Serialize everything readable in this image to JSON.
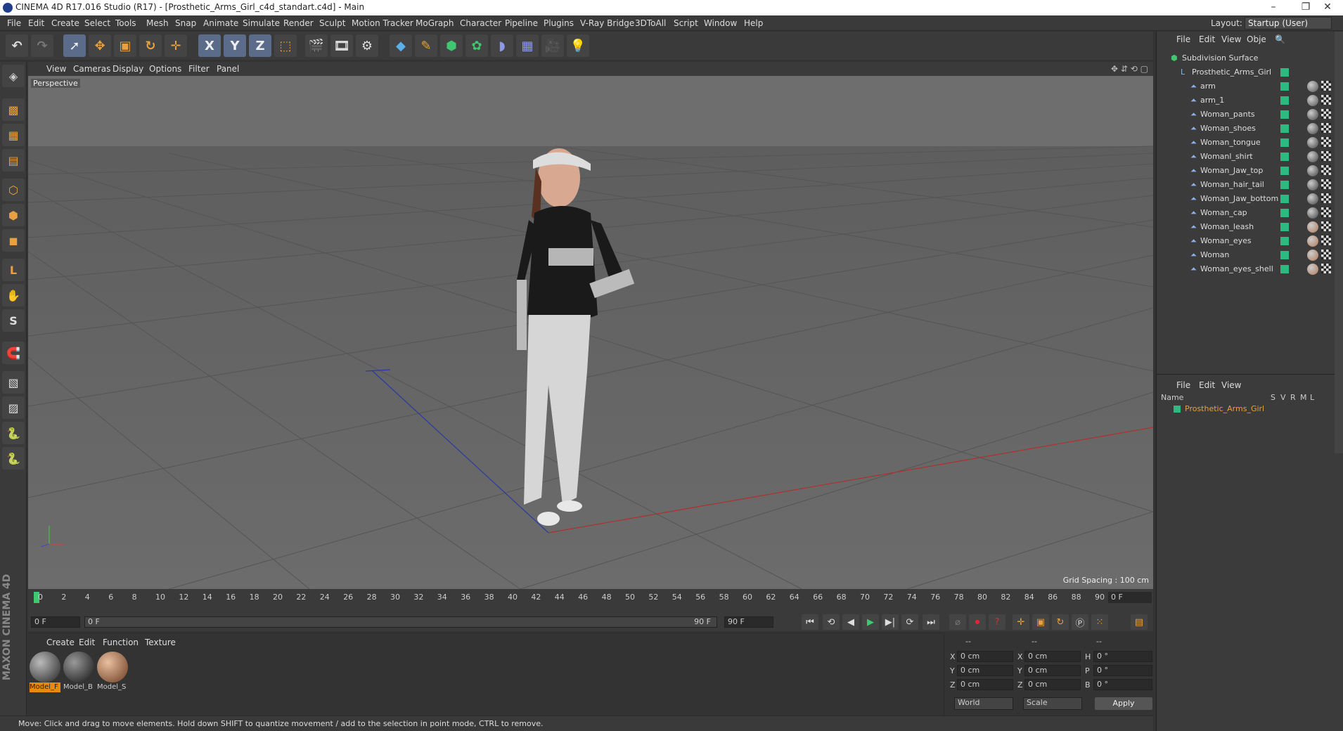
{
  "titlebar": {
    "title": "CINEMA 4D R17.016 Studio (R17) - [Prosthetic_Arms_Girl_c4d_standart.c4d] - Main",
    "minimize": "–",
    "restore": "❐",
    "close": "✕"
  },
  "menubar": {
    "items": [
      "File",
      "Edit",
      "Create",
      "Select",
      "Tools",
      "Mesh",
      "Snap",
      "Animate",
      "Simulate",
      "Render",
      "Sculpt",
      "Motion Tracker",
      "MoGraph",
      "Character",
      "Pipeline",
      "Plugins",
      "V-Ray Bridge",
      "3DToAll",
      "Script",
      "Window",
      "Help"
    ],
    "layout_label": "Layout:",
    "layout_value": "Startup (User)"
  },
  "toolbar": {
    "x_label": "X",
    "y_label": "Y",
    "z_label": "Z"
  },
  "viewport_menu": {
    "items": [
      "View",
      "Cameras",
      "Display",
      "Options",
      "Filter",
      "Panel"
    ]
  },
  "viewport": {
    "camera": "Perspective",
    "grid_spacing": "Grid Spacing : 100 cm"
  },
  "timeline": {
    "ticks": [
      "0",
      "2",
      "4",
      "6",
      "8",
      "10",
      "12",
      "14",
      "16",
      "18",
      "20",
      "22",
      "24",
      "26",
      "28",
      "30",
      "32",
      "34",
      "36",
      "38",
      "40",
      "42",
      "44",
      "46",
      "48",
      "50",
      "52",
      "54",
      "56",
      "58",
      "60",
      "62",
      "64",
      "66",
      "68",
      "70",
      "72",
      "74",
      "76",
      "78",
      "80",
      "82",
      "84",
      "86",
      "88",
      "90"
    ],
    "frame_display": "0 F"
  },
  "transport": {
    "start_frame": "0 F",
    "range_start": "0 F",
    "range_end": "90 F",
    "end_frame": "90 F"
  },
  "material_panel": {
    "menu": [
      "Create",
      "Edit",
      "Function",
      "Texture"
    ],
    "materials": [
      {
        "name": "Model_F",
        "color": "#444"
      },
      {
        "name": "Model_B",
        "color": "#222"
      },
      {
        "name": "Model_S",
        "color": "#b07a5a"
      }
    ]
  },
  "coords": {
    "header": [
      "--",
      "--",
      "--"
    ],
    "rows": [
      {
        "axis": "X",
        "pos": "0 cm",
        "axis2": "X",
        "size": "0 cm",
        "rot_label": "H",
        "rot": "0 °"
      },
      {
        "axis": "Y",
        "pos": "0 cm",
        "axis2": "Y",
        "size": "0 cm",
        "rot_label": "P",
        "rot": "0 °"
      },
      {
        "axis": "Z",
        "pos": "0 cm",
        "axis2": "Z",
        "size": "0 cm",
        "rot_label": "B",
        "rot": "0 °"
      }
    ],
    "mode_world": "World",
    "mode_scale": "Scale",
    "apply": "Apply"
  },
  "status": {
    "text": "Move: Click and drag to move elements. Hold down SHIFT to quantize movement / add to the selection in point mode, CTRL to remove."
  },
  "object_manager": {
    "menu": [
      "File",
      "Edit",
      "View",
      "Obje"
    ],
    "root": "Subdivision Surface",
    "group": "Prosthetic_Arms_Girl",
    "objects": [
      "arm",
      "arm_1",
      "Woman_pants",
      "Woman_shoes",
      "Woman_tongue",
      "Womanl_shirt",
      "Woman_Jaw_top",
      "Woman_hair_tail",
      "Woman_Jaw_bottom",
      "Woman_cap",
      "Woman_leash",
      "Woman_eyes",
      "Woman",
      "Woman_eyes_shell"
    ]
  },
  "attribute_manager": {
    "menu": [
      "File",
      "Edit",
      "View"
    ],
    "col_name": "Name",
    "cols": [
      "S",
      "V",
      "R",
      "M",
      "L"
    ],
    "selected": "Prosthetic_Arms_Girl"
  },
  "colors": {
    "accent": "#e88a10",
    "object_dot": "#2db980",
    "selected_text": "#e8a040"
  }
}
